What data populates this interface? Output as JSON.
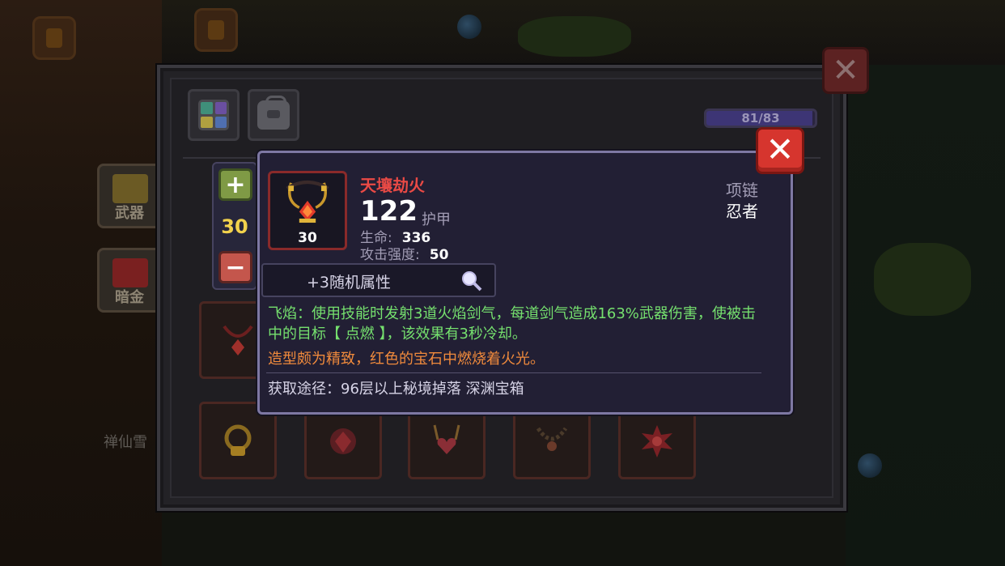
{
  "background": {
    "npc_name": "禅仙雪",
    "side_buttons": [
      {
        "label": "武器",
        "icon": "weapon-icon"
      },
      {
        "label": "暗金",
        "icon": "dark-gold-icon"
      }
    ]
  },
  "inventory": {
    "tabs": [
      {
        "icon": "grid-icon"
      },
      {
        "icon": "bag-icon"
      }
    ],
    "capacity": {
      "text": "81/83",
      "used": 81,
      "max": 83
    },
    "close_icon": "close-icon"
  },
  "stepper": {
    "plus_icon": "plus-icon",
    "minus_icon": "minus-icon",
    "value": "30"
  },
  "tooltip": {
    "name": "天壤劫火",
    "name_color": "#ea4a45",
    "main_value": "122",
    "main_label": "护甲",
    "level": "30",
    "stats": [
      {
        "label": "生命:",
        "value": "336"
      },
      {
        "label": "攻击强度:",
        "value": "50"
      }
    ],
    "type": "项链",
    "class": "忍者",
    "random_attr": "+3随机属性",
    "effect": "飞焰：使用技能时发射3道火焰剑气，每道剑气造成163%武器伤害，使被击中的目标【 点燃 】，该效果有3秒冷却。",
    "flavor": "造型颇为精致，红色的宝石中燃烧着火光。",
    "source": "获取途径：96层以上秘境掉落 深渊宝箱",
    "effect_color": "#75e06e",
    "flavor_color": "#f08a3c"
  }
}
